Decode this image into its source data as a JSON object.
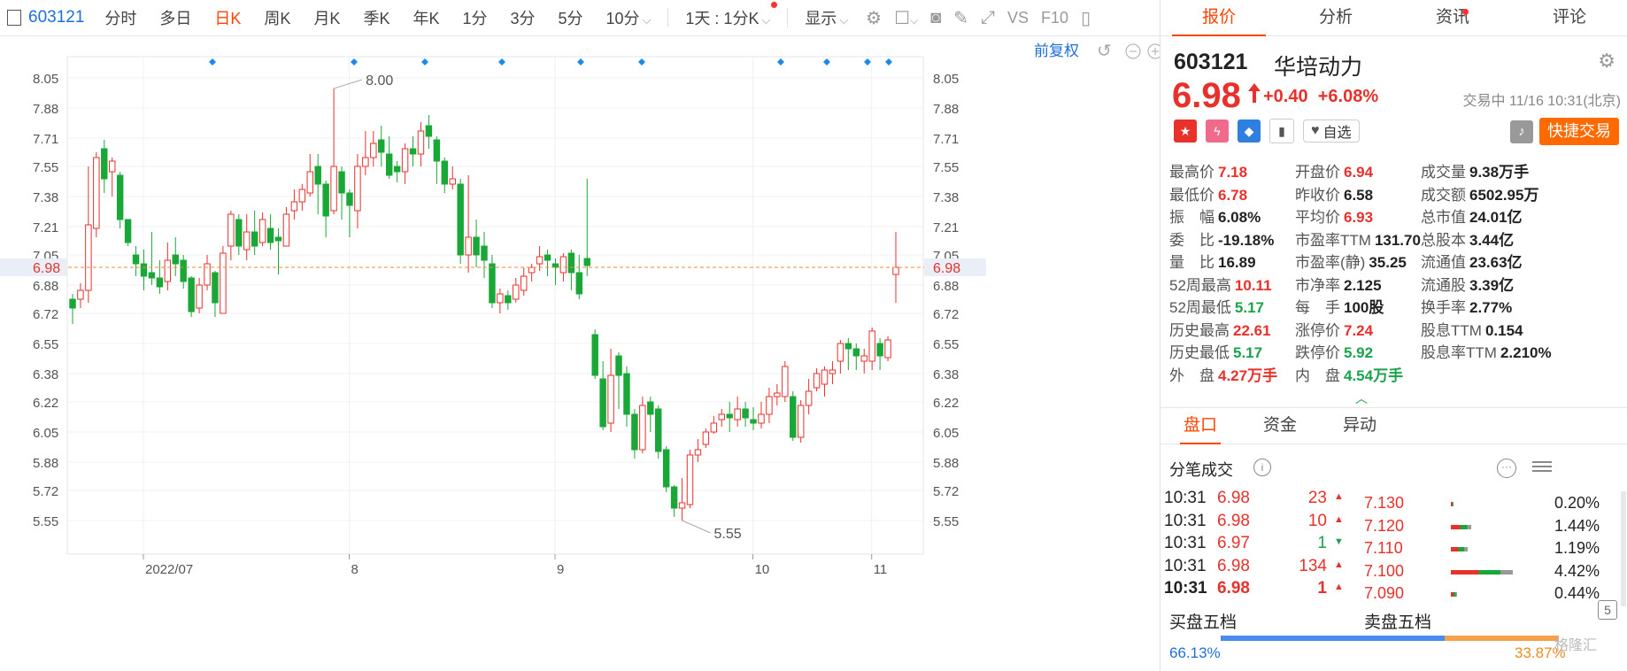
{
  "toolbar": {
    "code": "603121",
    "periods": [
      "分时",
      "多日",
      "日K",
      "周K",
      "月K",
      "季K",
      "年K",
      "1分",
      "3分",
      "5分",
      "10分"
    ],
    "active_period": "日K",
    "resample": "1天 : 1分K",
    "display": "显示"
  },
  "chart": {
    "restore_label": "前复权",
    "price_axis": [
      "8.05",
      "7.88",
      "7.71",
      "7.55",
      "7.38",
      "7.21",
      "7.05",
      "6.88",
      "6.72",
      "6.55",
      "6.38",
      "6.22",
      "6.05",
      "5.88",
      "5.72",
      "5.55"
    ],
    "current_price_tag": "6.98",
    "date_labels": [
      "2022/07",
      "8",
      "9",
      "10",
      "11"
    ],
    "high_label": "8.00",
    "low_label": "5.55",
    "colors": {
      "up": "#e8312b",
      "down": "#19a838",
      "line": "#f0883a",
      "marker": "#1e88e5"
    }
  },
  "chart_data": {
    "type": "candlestick",
    "title": "",
    "ylim": [
      5.48,
      8.1
    ],
    "x_labels": [
      "2022/07",
      "8",
      "9",
      "10",
      "11"
    ],
    "candles": [
      [
        6.8,
        6.75,
        6.83,
        6.66
      ],
      [
        6.8,
        6.85,
        6.89,
        6.75
      ],
      [
        6.85,
        7.22,
        7.55,
        6.78
      ],
      [
        7.2,
        7.6,
        7.63,
        7.15
      ],
      [
        7.65,
        7.48,
        7.7,
        7.4
      ],
      [
        7.52,
        7.58,
        7.6,
        7.38
      ],
      [
        7.5,
        7.25,
        7.52,
        7.2
      ],
      [
        7.25,
        7.12,
        7.25,
        7.1
      ],
      [
        7.05,
        7.0,
        7.1,
        6.93
      ],
      [
        7.0,
        6.93,
        7.08,
        6.85
      ],
      [
        6.95,
        6.92,
        7.18,
        6.88
      ],
      [
        6.92,
        6.87,
        7.02,
        6.83
      ],
      [
        6.9,
        7.02,
        7.12,
        6.85
      ],
      [
        7.05,
        7.0,
        7.15,
        6.93
      ],
      [
        7.02,
        6.9,
        7.05,
        6.86
      ],
      [
        6.92,
        6.73,
        6.93,
        6.7
      ],
      [
        6.75,
        6.88,
        6.92,
        6.72
      ],
      [
        6.88,
        7.0,
        7.05,
        6.85
      ],
      [
        6.95,
        6.78,
        6.96,
        6.7
      ],
      [
        6.72,
        7.06,
        7.1,
        6.72
      ],
      [
        7.1,
        7.28,
        7.3,
        7.02
      ],
      [
        7.25,
        7.1,
        7.28,
        7.05
      ],
      [
        7.08,
        7.18,
        7.28,
        7.02
      ],
      [
        7.18,
        7.1,
        7.3,
        7.05
      ],
      [
        7.12,
        7.25,
        7.29,
        7.1
      ],
      [
        7.2,
        7.12,
        7.28,
        7.08
      ],
      [
        7.15,
        7.13,
        7.2,
        6.94
      ],
      [
        7.1,
        7.28,
        7.32,
        7.1
      ],
      [
        7.3,
        7.35,
        7.42,
        7.25
      ],
      [
        7.35,
        7.42,
        7.45,
        7.3
      ],
      [
        7.4,
        7.52,
        7.62,
        7.38
      ],
      [
        7.55,
        7.45,
        7.62,
        7.28
      ],
      [
        7.45,
        7.27,
        7.47,
        7.15
      ],
      [
        7.3,
        7.55,
        7.99,
        7.28
      ],
      [
        7.52,
        7.4,
        7.55,
        7.25
      ],
      [
        7.4,
        7.33,
        7.42,
        7.15
      ],
      [
        7.3,
        7.55,
        7.62,
        7.2
      ],
      [
        7.55,
        7.6,
        7.75,
        7.5
      ],
      [
        7.6,
        7.68,
        7.75,
        7.55
      ],
      [
        7.7,
        7.63,
        7.78,
        7.55
      ],
      [
        7.62,
        7.5,
        7.72,
        7.48
      ],
      [
        7.55,
        7.52,
        7.58,
        7.46
      ],
      [
        7.52,
        7.65,
        7.68,
        7.45
      ],
      [
        7.65,
        7.62,
        7.72,
        7.55
      ],
      [
        7.62,
        7.75,
        7.8,
        7.55
      ],
      [
        7.78,
        7.72,
        7.84,
        7.65
      ],
      [
        7.7,
        7.58,
        7.72,
        7.45
      ],
      [
        7.58,
        7.45,
        7.6,
        7.4
      ],
      [
        7.45,
        7.48,
        7.55,
        7.42
      ],
      [
        7.45,
        7.05,
        7.48,
        7.0
      ],
      [
        7.05,
        7.15,
        7.5,
        6.95
      ],
      [
        7.15,
        7.05,
        7.25,
        6.98
      ],
      [
        7.1,
        7.02,
        7.18,
        6.92
      ],
      [
        7.0,
        6.78,
        7.05,
        6.75
      ],
      [
        6.78,
        6.83,
        6.86,
        6.72
      ],
      [
        6.82,
        6.78,
        6.85,
        6.74
      ],
      [
        6.8,
        6.88,
        6.92,
        6.78
      ],
      [
        6.85,
        6.93,
        6.98,
        6.82
      ],
      [
        6.95,
        6.98,
        7.0,
        6.9
      ],
      [
        7.0,
        7.04,
        7.1,
        6.96
      ],
      [
        7.05,
        7.02,
        7.08,
        6.93
      ],
      [
        7.0,
        6.98,
        7.03,
        6.88
      ],
      [
        6.95,
        7.04,
        7.06,
        6.9
      ],
      [
        7.06,
        6.95,
        7.08,
        6.85
      ],
      [
        6.95,
        6.83,
        7.05,
        6.8
      ],
      [
        7.03,
        6.99,
        7.48,
        6.93
      ],
      [
        6.6,
        6.37,
        6.63,
        6.35
      ],
      [
        6.35,
        6.08,
        6.45,
        6.06
      ],
      [
        6.1,
        6.37,
        6.52,
        6.05
      ],
      [
        6.48,
        6.37,
        6.5,
        6.18
      ],
      [
        6.38,
        6.15,
        6.42,
        6.08
      ],
      [
        6.15,
        5.95,
        6.18,
        5.9
      ],
      [
        5.95,
        6.2,
        6.25,
        5.93
      ],
      [
        6.22,
        6.15,
        6.25,
        6.05
      ],
      [
        6.18,
        5.94,
        6.2,
        5.9
      ],
      [
        5.95,
        5.74,
        5.97,
        5.71
      ],
      [
        5.74,
        5.62,
        5.75,
        5.57
      ],
      [
        5.62,
        5.65,
        5.79,
        5.55
      ],
      [
        5.64,
        5.92,
        5.95,
        5.62
      ],
      [
        5.92,
        5.95,
        6.01,
        5.88
      ],
      [
        5.98,
        6.05,
        6.07,
        5.96
      ],
      [
        6.05,
        6.1,
        6.14,
        6.04
      ],
      [
        6.12,
        6.15,
        6.18,
        6.08
      ],
      [
        6.15,
        6.13,
        6.22,
        6.05
      ],
      [
        6.12,
        6.18,
        6.25,
        6.08
      ],
      [
        6.18,
        6.13,
        6.22,
        6.08
      ],
      [
        6.12,
        6.1,
        6.19,
        6.06
      ],
      [
        6.1,
        6.15,
        6.22,
        6.07
      ],
      [
        6.15,
        6.25,
        6.3,
        6.1
      ],
      [
        6.25,
        6.27,
        6.32,
        6.2
      ],
      [
        6.25,
        6.42,
        6.45,
        6.22
      ],
      [
        6.25,
        6.02,
        6.28,
        6.0
      ],
      [
        6.02,
        6.2,
        6.23,
        5.99
      ],
      [
        6.2,
        6.28,
        6.35,
        6.15
      ],
      [
        6.3,
        6.38,
        6.41,
        6.28
      ],
      [
        6.32,
        6.4,
        6.42,
        6.25
      ],
      [
        6.38,
        6.4,
        6.45,
        6.32
      ],
      [
        6.45,
        6.55,
        6.57,
        6.38
      ],
      [
        6.55,
        6.52,
        6.58,
        6.4
      ],
      [
        6.52,
        6.48,
        6.55,
        6.4
      ],
      [
        6.45,
        6.48,
        6.52,
        6.38
      ],
      [
        6.45,
        6.62,
        6.64,
        6.4
      ],
      [
        6.55,
        6.48,
        6.58,
        6.4
      ],
      [
        6.47,
        6.57,
        6.59,
        6.45
      ],
      [
        6.94,
        6.98,
        7.18,
        6.78
      ]
    ]
  },
  "tabs": [
    "报价",
    "分析",
    "资讯",
    "评论"
  ],
  "active_tab": "报价",
  "quote": {
    "code": "603121",
    "name": "华培动力",
    "price": "6.98",
    "change": "+0.40",
    "change_pct": "+6.08%",
    "status": "交易中 11/16 10:31(北京)",
    "watchlist_label": "自选",
    "fast_trade_label": "快捷交易",
    "fields": [
      [
        {
          "label": "最高价",
          "value": "7.18",
          "c": "up"
        },
        {
          "label": "开盘价",
          "value": "6.94",
          "c": "up"
        },
        {
          "label": "成交量",
          "value": "9.38万手",
          "c": "nt"
        }
      ],
      [
        {
          "label": "最低价",
          "value": "6.78",
          "c": "up"
        },
        {
          "label": "昨收价",
          "value": "6.58",
          "c": "nt"
        },
        {
          "label": "成交额",
          "value": "6502.95万",
          "c": "nt"
        }
      ],
      [
        {
          "label": "振　幅",
          "value": "6.08%",
          "c": "nt"
        },
        {
          "label": "平均价",
          "value": "6.93",
          "c": "up"
        },
        {
          "label": "总市值",
          "value": "24.01亿",
          "c": "nt"
        }
      ],
      [
        {
          "label": "委　比",
          "value": "-19.18%",
          "c": "nt"
        },
        {
          "label": "市盈率TTM",
          "value": "131.70",
          "c": "nt"
        },
        {
          "label": "总股本",
          "value": "3.44亿",
          "c": "nt"
        }
      ],
      [
        {
          "label": "量　比",
          "value": "16.89",
          "c": "nt"
        },
        {
          "label": "市盈率(静)",
          "value": "35.25",
          "c": "nt"
        },
        {
          "label": "流通值",
          "value": "23.63亿",
          "c": "nt"
        }
      ],
      [
        {
          "label": "52周最高",
          "value": "10.11",
          "c": "up"
        },
        {
          "label": "市净率",
          "value": "2.125",
          "c": "nt"
        },
        {
          "label": "流通股",
          "value": "3.39亿",
          "c": "nt"
        }
      ],
      [
        {
          "label": "52周最低",
          "value": "5.17",
          "c": "dn"
        },
        {
          "label": "每　手",
          "value": "100股",
          "c": "nt"
        },
        {
          "label": "换手率",
          "value": "2.77%",
          "c": "nt"
        }
      ],
      [
        {
          "label": "历史最高",
          "value": "22.61",
          "c": "up"
        },
        {
          "label": "涨停价",
          "value": "7.24",
          "c": "up"
        },
        {
          "label": "股息TTM",
          "value": "0.154",
          "c": "nt"
        }
      ],
      [
        {
          "label": "历史最低",
          "value": "5.17",
          "c": "dn"
        },
        {
          "label": "跌停价",
          "value": "5.92",
          "c": "dn"
        },
        {
          "label": "股息率TTM",
          "value": "2.210%",
          "c": "nt"
        }
      ],
      [
        {
          "label": "外　盘",
          "value": "4.27万手",
          "c": "up"
        },
        {
          "label": "内　盘",
          "value": "4.54万手",
          "c": "dn"
        }
      ]
    ]
  },
  "subtabs": [
    "盘口",
    "资金",
    "异动"
  ],
  "active_subtab": "盘口",
  "ticks_label": "分笔成交",
  "ticks": [
    {
      "time": "10:31",
      "price": "6.98",
      "vol": "23",
      "dir": "up"
    },
    {
      "time": "10:31",
      "price": "6.98",
      "vol": "10",
      "dir": "up"
    },
    {
      "time": "10:31",
      "price": "6.97",
      "vol": "1",
      "dir": "dn"
    },
    {
      "time": "10:31",
      "price": "6.98",
      "vol": "134",
      "dir": "up"
    },
    {
      "time": "10:31",
      "price": "6.98",
      "vol": "1",
      "dir": "up"
    }
  ],
  "price_dist": [
    {
      "price": "7.130",
      "pct": "0.20%",
      "share": 0.2
    },
    {
      "price": "7.120",
      "pct": "1.44%",
      "share": 1.44
    },
    {
      "price": "7.110",
      "pct": "1.19%",
      "share": 1.19
    },
    {
      "price": "7.100",
      "pct": "4.42%",
      "share": 4.42
    },
    {
      "price": "7.090",
      "pct": "0.44%",
      "share": 0.44
    }
  ],
  "orderbook": {
    "buy_label": "买盘五档",
    "sell_label": "卖盘五档",
    "buy_pct": "66.13%",
    "sell_pct": "33.87%",
    "buy_share": 66.13,
    "five": "5"
  },
  "watermark": "格隆汇"
}
